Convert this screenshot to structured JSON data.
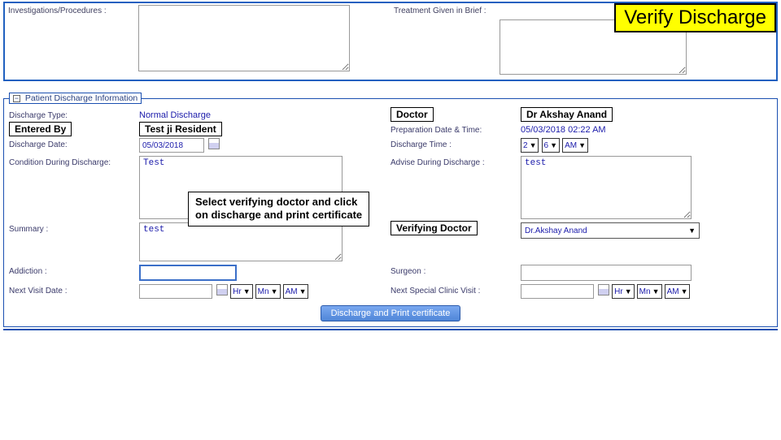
{
  "banner": {
    "verify": "Verify Discharge"
  },
  "top": {
    "investigations_label": "Investigations/Procedures :",
    "treatment_label": "Treatment Given in Brief :",
    "investigations_value": "",
    "treatment_value": ""
  },
  "section": {
    "title": "Patient Discharge Information"
  },
  "annotations": {
    "entered_by": "Entered By",
    "doctor": "Doctor",
    "dr_name": "Dr Akshay Anand",
    "verifying_doctor": "Verifying Doctor",
    "callout_l1": "Select verifying doctor and click",
    "callout_l2": "on discharge and print certificate"
  },
  "labels": {
    "discharge_type": "Discharge Type:",
    "discharge_date": "Discharge Date:",
    "condition": "Condition During Discharge:",
    "summary": "Summary :",
    "addiction": "Addiction :",
    "next_visit": "Next Visit Date :",
    "prep_date": "Preparation Date & Time:",
    "discharge_time": "Discharge Time :",
    "advise": "Advise During Discharge :",
    "surgeon": "Surgeon :",
    "next_clinic": "Next Special Clinic Visit :",
    "hr": "Hr",
    "mn": "Mn",
    "am": "AM"
  },
  "values": {
    "discharge_type_val": "Normal Discharge",
    "entered_by_name": "Test ji Resident",
    "discharge_date": "05/03/2018",
    "condition": "Test",
    "summary": "test",
    "addiction": "",
    "next_visit": "",
    "prep_datetime": "05/03/2018 02:22 AM",
    "time_hr": "2",
    "time_mn": "6",
    "time_ampm": "AM",
    "advise": "test",
    "surgeon": "",
    "verifying_doctor_name": "Dr.Akshay Anand",
    "next_clinic": ""
  },
  "buttons": {
    "discharge_print": "Discharge and Print certificate"
  }
}
